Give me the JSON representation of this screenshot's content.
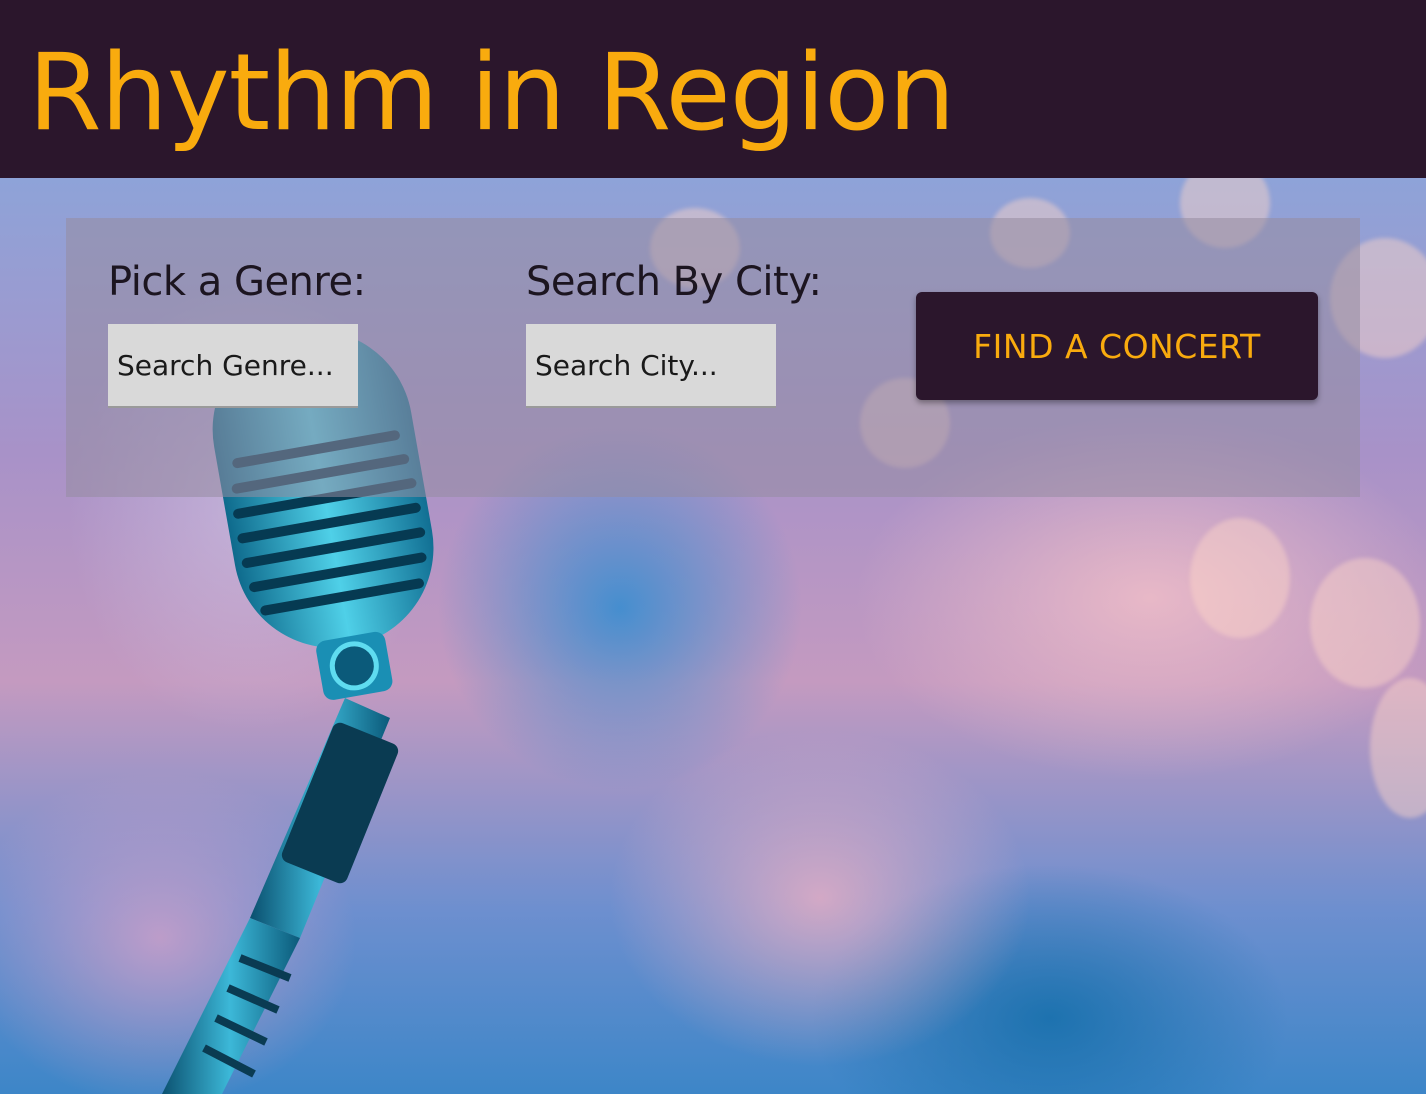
{
  "header": {
    "title": "Rhythm in Region"
  },
  "search": {
    "genre_label": "Pick a Genre:",
    "genre_placeholder": "Search Genre...",
    "city_label": "Search By City:",
    "city_placeholder": "Search City...",
    "submit_label": "FIND A CONCERT"
  },
  "colors": {
    "header_bg": "#2b162c",
    "accent": "#f9ab0e",
    "input_bg": "#d9d9d9"
  }
}
